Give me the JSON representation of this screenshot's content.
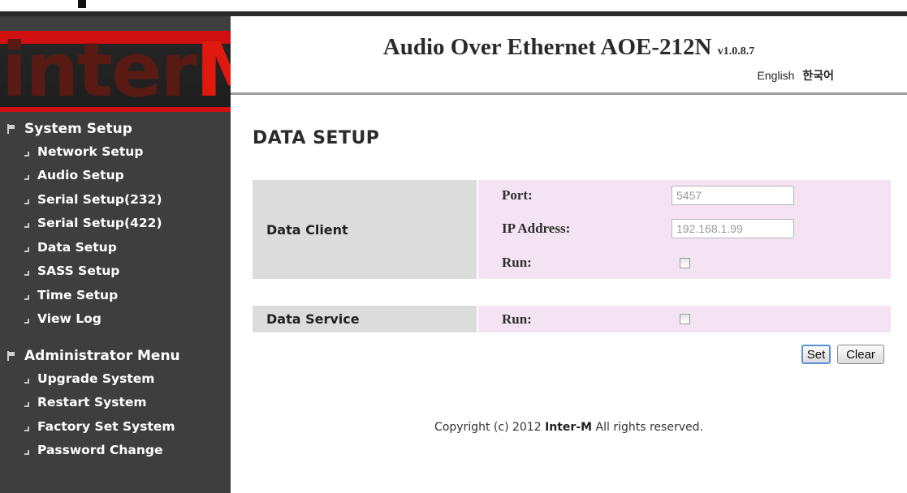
{
  "header": {
    "title": "Audio Over Ethernet AOE-212N",
    "version": "v1.0.8.7",
    "languages": [
      "English",
      "한국어"
    ]
  },
  "logo": {
    "text_main": "inter",
    "text_accent": "M"
  },
  "sidebar": {
    "sections": [
      {
        "title": "System Setup",
        "items": [
          "Network Setup",
          "Audio Setup",
          "Serial Setup(232)",
          "Serial Setup(422)",
          "Data Setup",
          "SASS Setup",
          "Time Setup",
          "View Log"
        ]
      },
      {
        "title": "Administrator Menu",
        "items": [
          "Upgrade System",
          "Restart System",
          "Factory Set System",
          "Password Change"
        ]
      }
    ]
  },
  "content": {
    "page_title": "DATA SETUP",
    "data_client": {
      "label": "Data Client",
      "port_label": "Port:",
      "port_value": "5457",
      "ip_label": "IP Address:",
      "ip_value": "192.168.1.99",
      "run_label": "Run:",
      "run_checked": false
    },
    "data_service": {
      "label": "Data Service",
      "run_label": "Run:",
      "run_checked": false
    },
    "buttons": {
      "set": "Set",
      "clear": "Clear"
    }
  },
  "footer": {
    "copyright_prefix": "Copyright (c) 2012",
    "copyright_brand": "Inter-M",
    "copyright_suffix": "All rights reserved."
  },
  "colors": {
    "sidebar_bg": "#3e3e3e",
    "brand_red": "#e0190f",
    "label_cell_bg": "#dcdcdc",
    "field_panel_bg": "#f3e3f3"
  }
}
